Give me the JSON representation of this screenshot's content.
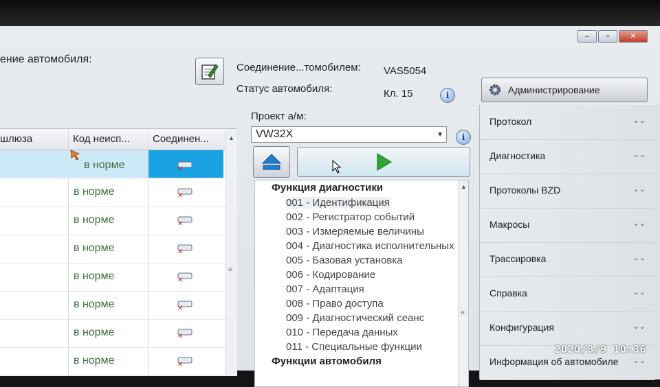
{
  "window": {
    "title_fragment": "ение автомобиля:",
    "controls": [
      "–",
      "▫",
      "✕"
    ]
  },
  "connection": {
    "label": "Соединение...томобилем:",
    "value": "VAS5054",
    "status_label": "Статус автомобиля:",
    "status_value": "Кл. 15"
  },
  "admin_button": {
    "label": "Администрирование"
  },
  "table": {
    "headers": [
      "шлюза",
      "Код неисп...",
      "Соединен..."
    ],
    "rows": [
      {
        "status": "в норме"
      },
      {
        "status": "в норме"
      },
      {
        "status": "в норме"
      },
      {
        "status": "в норме"
      },
      {
        "status": "в норме"
      },
      {
        "status": "в норме"
      },
      {
        "status": "в норме"
      },
      {
        "status": "в норме"
      }
    ]
  },
  "project": {
    "label": "Проект а/м:",
    "selected": "VW32X"
  },
  "tree": {
    "group1": "Функция диагностики",
    "functions": [
      "001 - Идентификация",
      "002 - Регистратор событий",
      "003 - Измеряемые величины",
      "004 - Диагностика исполнительных",
      "005 - Базовая установка",
      "006 - Кодирование",
      "007 - Адаптация",
      "008 - Право доступа",
      "009 - Диагностический сеанс",
      "010 - Передача данных",
      "011 - Специальные функции"
    ],
    "group2": "Функции автомобиля"
  },
  "right_panel": {
    "items": [
      "Протокол",
      "Диагностика",
      "Протоколы BZD",
      "Макросы",
      "Трассировка",
      "Справка",
      "Конфигурация",
      "Информация об автомобиле"
    ]
  },
  "photo_timestamp": "2020/8/9  10:36",
  "colors": {
    "selected_cell": "#1aa1e2",
    "ok_text": "#3a6e3a",
    "play_green": "#2ea82e"
  }
}
